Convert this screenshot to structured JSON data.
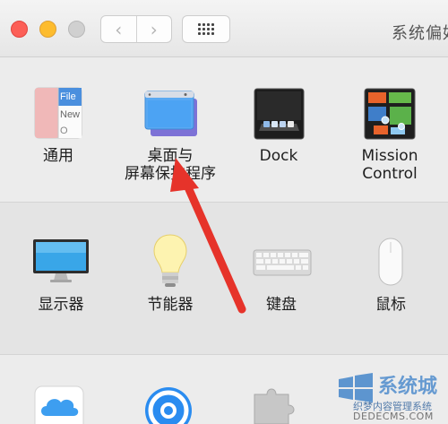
{
  "window": {
    "title": "系统偏好"
  },
  "toolbar": {
    "back_glyph": "‹",
    "forward_glyph": "›"
  },
  "rows": [
    {
      "items": [
        {
          "id": "general",
          "label": "通用",
          "icon": "general-icon"
        },
        {
          "id": "desktop",
          "label_line1": "桌面与",
          "label_line2": "屏幕保护程序",
          "icon": "desktop-screensaver-icon"
        },
        {
          "id": "dock",
          "label": "Dock",
          "icon": "dock-icon"
        },
        {
          "id": "mission",
          "label_line1": "Mission",
          "label_line2": "Control",
          "icon": "mission-control-icon"
        }
      ]
    },
    {
      "items": [
        {
          "id": "displays",
          "label": "显示器",
          "icon": "displays-icon"
        },
        {
          "id": "energy",
          "label": "节能器",
          "icon": "energy-saver-icon"
        },
        {
          "id": "keyboard",
          "label": "键盘",
          "icon": "keyboard-icon"
        },
        {
          "id": "mouse",
          "label": "鼠标",
          "icon": "mouse-icon"
        }
      ]
    },
    {
      "items": [
        {
          "id": "icloud",
          "icon": "icloud-icon"
        },
        {
          "id": "internet-accounts",
          "icon": "internet-accounts-icon"
        },
        {
          "id": "extensions",
          "icon": "extensions-icon"
        }
      ]
    }
  ],
  "general_icon_text": {
    "line1": "File",
    "line2": "New",
    "line3": "O"
  },
  "watermark": {
    "brand": "系统城",
    "tagline": "织梦内容管理系统",
    "url": "DEDECMS.COM"
  },
  "colors": {
    "arrow": "#e6332a",
    "accent_blue": "#3a7fc8"
  }
}
